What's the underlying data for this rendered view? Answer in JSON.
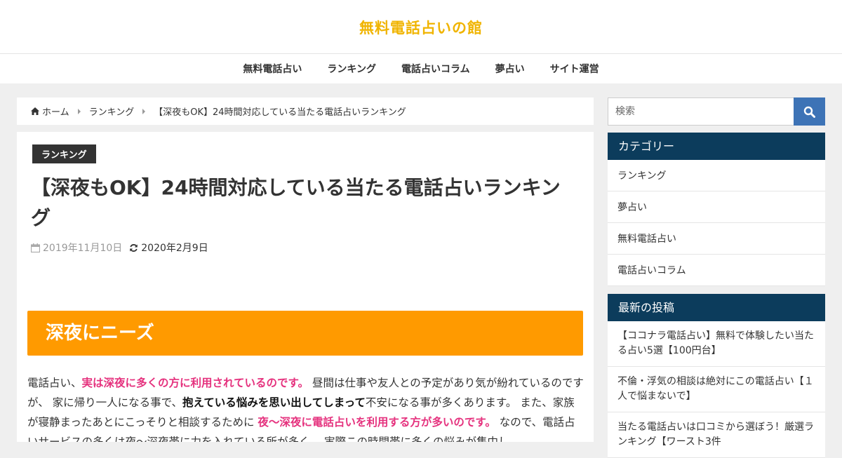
{
  "site": {
    "title": "無料電話占いの館"
  },
  "nav": [
    {
      "label": "無料電話占い"
    },
    {
      "label": "ランキング"
    },
    {
      "label": "電話占いコラム"
    },
    {
      "label": "夢占い"
    },
    {
      "label": "サイト運営"
    }
  ],
  "breadcrumb": [
    {
      "label": "ホーム",
      "icon": "home-icon"
    },
    {
      "label": "ランキング"
    },
    {
      "label": "【深夜もOK】24時間対応している当たる電話占いランキング"
    }
  ],
  "article": {
    "category": "ランキング",
    "title": "【深夜もOK】24時間対応している当たる電話占いランキング",
    "published": "2019年11月10日",
    "updated": "2020年2月9日",
    "heading": "深夜にニーズ",
    "paragraph": [
      {
        "text": "電話占い、",
        "style": "normal"
      },
      {
        "text": "実は深夜に多くの方に利用されているのです。",
        "style": "highlight"
      },
      {
        "text": " 昼間は仕事や友人との予定があり気が紛れているのですが、 家に帰り一人になる事で、",
        "style": "normal"
      },
      {
        "text": "抱えている悩みを思い出してしまって",
        "style": "bold"
      },
      {
        "text": "不安になる事が多くあります。 また、家族が寝静まったあとにこっそりと相談するために ",
        "style": "normal"
      },
      {
        "text": "夜〜深夜に電話占いを利用する方が多いのです。",
        "style": "highlight"
      },
      {
        "text": " なので、電話占いサービスの多くは夜〜深夜帯に力を入れている所が多く、 実際この時間帯に多くの悩みが集中し",
        "style": "normal"
      }
    ]
  },
  "search": {
    "placeholder": "検索"
  },
  "sidebar": {
    "categories": {
      "title": "カテゴリー",
      "items": [
        {
          "label": "ランキング"
        },
        {
          "label": "夢占い"
        },
        {
          "label": "無料電話占い"
        },
        {
          "label": "電話占いコラム"
        }
      ]
    },
    "recent": {
      "title": "最新の投稿",
      "items": [
        {
          "label": "【ココナラ電話占い】無料で体験したい当たる占い5選【100円台】"
        },
        {
          "label": "不倫・浮気の相談は絶対にこの電話占い【１人で悩まないで】"
        },
        {
          "label": "当たる電話占いは口コミから選ぼう！厳選ランキング【ワースト3件"
        }
      ]
    }
  },
  "colors": {
    "site_title": "#f0b400",
    "heading_bg": "#ff9a00",
    "highlight": "#e5327e",
    "widget_title_bg": "#0c3c5c",
    "search_button": "#3d73b6"
  }
}
